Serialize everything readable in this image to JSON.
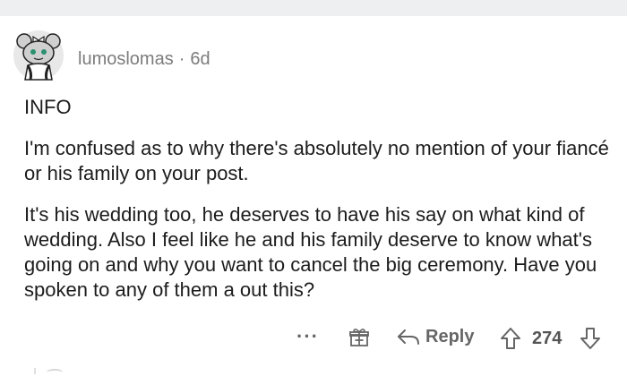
{
  "comment": {
    "username": "lumoslomas",
    "separator": "·",
    "age": "6d",
    "paragraphs": [
      "INFO",
      "I'm confused as to why there's absolutely no mention of your fiancé or his family on your post.",
      "It's his wedding too, he deserves to have his say on what kind of wedding. Also I feel like he and his family deserve to know what's going on and why you want to cancel the big ceremony. Have you spoken to any of them a out this?"
    ]
  },
  "actions": {
    "more_label": "···",
    "reply_label": "Reply",
    "score": "274"
  },
  "icons": {
    "avatar": "reddit-snoo-avatar",
    "more": "more-options-icon",
    "award": "award-gift-icon",
    "reply": "reply-arrow-icon",
    "upvote": "upvote-arrow-icon",
    "downvote": "downvote-arrow-icon"
  },
  "colors": {
    "background": "#ffffff",
    "top_bar": "#edeff1",
    "meta_text": "#7c7c7c",
    "body_text": "#1c1c1c"
  }
}
